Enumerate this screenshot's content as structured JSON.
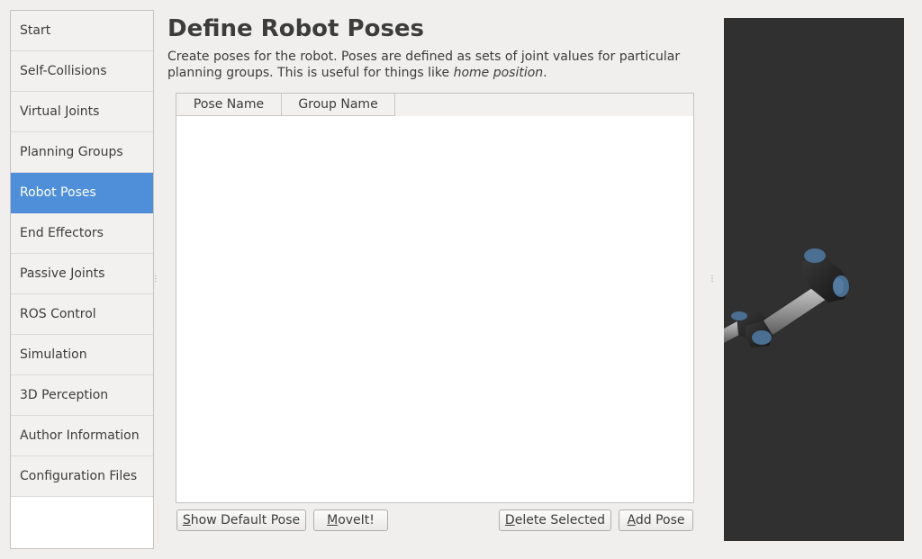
{
  "sidebar": {
    "items": [
      {
        "label": "Start"
      },
      {
        "label": "Self-Collisions"
      },
      {
        "label": "Virtual Joints"
      },
      {
        "label": "Planning Groups"
      },
      {
        "label": "Robot Poses",
        "active": true
      },
      {
        "label": "End Effectors"
      },
      {
        "label": "Passive Joints"
      },
      {
        "label": "ROS Control"
      },
      {
        "label": "Simulation"
      },
      {
        "label": "3D Perception"
      },
      {
        "label": "Author Information"
      },
      {
        "label": "Configuration Files"
      }
    ],
    "active_color": "#4f8fd9"
  },
  "main": {
    "title": "Define Robot Poses",
    "description": "Create poses for the robot. Poses are defined as sets of joint values for particular planning groups. This is useful for things like ",
    "description_emphasis": "home position",
    "description_end": ".",
    "table": {
      "columns": [
        "Pose Name",
        "Group Name"
      ],
      "rows": []
    },
    "buttons": {
      "show_default_pose": {
        "mnemonic": "S",
        "rest": "how Default Pose"
      },
      "moveit": {
        "mnemonic": "M",
        "rest": "oveIt!"
      },
      "delete_selected": {
        "mnemonic": "D",
        "rest": "elete Selected"
      },
      "add_pose": {
        "mnemonic": "A",
        "rest": "dd Pose"
      }
    }
  },
  "viewer": {
    "background": "#303030",
    "link_color": "#2a2a2a",
    "joint_cap_color": "#4a6f93"
  }
}
